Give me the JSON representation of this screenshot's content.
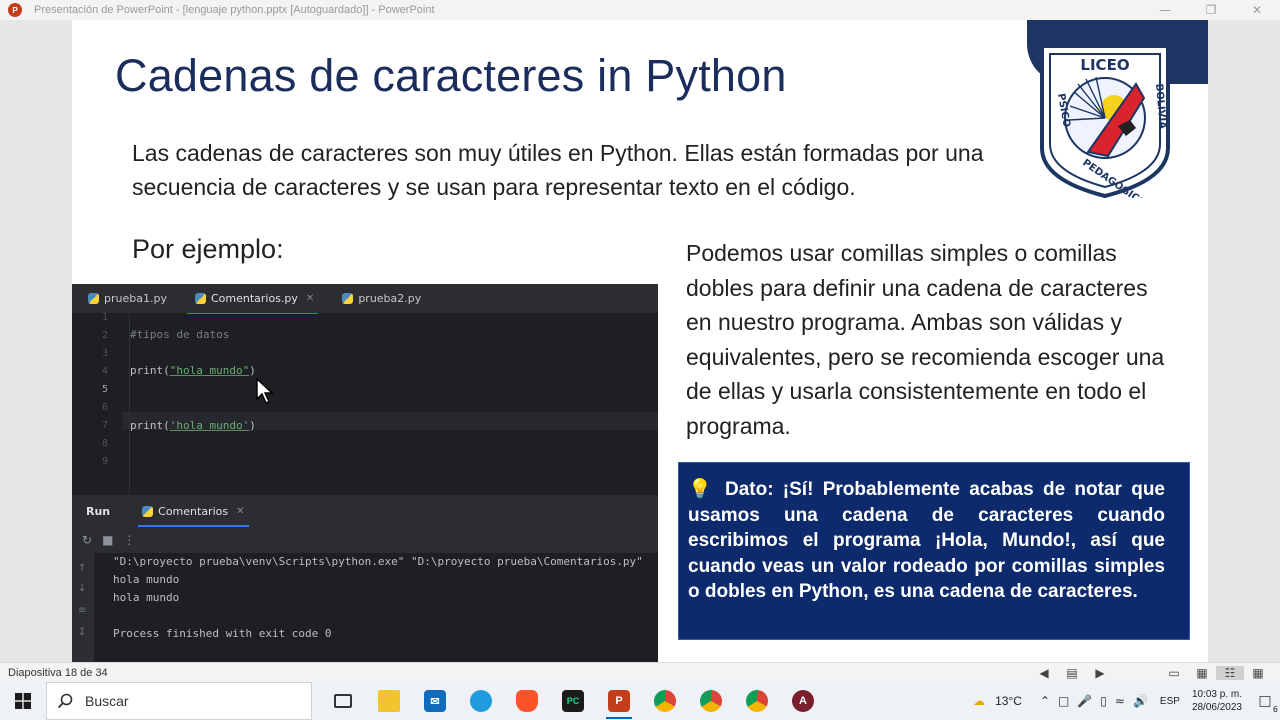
{
  "window": {
    "title": "Presentación de PowerPoint - [lenguaje python.pptx [Autoguardado]] - PowerPoint",
    "app_icon_letter": "P"
  },
  "slide": {
    "title": "Cadenas de caracteres in Python",
    "intro": "Las cadenas de caracteres son muy útiles en Python. Ellas están formadas por una secuencia de caracteres y se usan para representar texto en el código.",
    "por_ejemplo": "Por ejemplo:",
    "right_text": "Podemos usar comillas simples o comillas dobles para definir una cadena de caracteres en nuestro programa. Ambas son válidas y equivalentes, pero se recomienda escoger una de ellas y usarla consistentemente en todo el programa.",
    "dato_icon": "lightbulb-icon",
    "dato_text": "Dato: ¡Sí! Probablemente acabas de notar que usamos una cadena de caracteres cuando escribimos el programa ¡Hola, Mundo!, así que cuando veas un valor rodeado por comillas simples o dobles en Python, es una cadena de caracteres.",
    "logo": {
      "top_text": "LICEO",
      "left_text": "PSICOPEDAGOGICO",
      "right_text": "BOLIVIA"
    }
  },
  "ide": {
    "tabs": [
      {
        "label": "prueba1.py",
        "active": false,
        "closable": false
      },
      {
        "label": "Comentarios.py",
        "active": true,
        "closable": true
      },
      {
        "label": "prueba2.py",
        "active": false,
        "closable": false
      }
    ],
    "line_numbers": [
      "1",
      "2",
      "3",
      "4",
      "5",
      "6",
      "7",
      "8",
      "9"
    ],
    "current_line": "5",
    "code": {
      "line2": "#tipos de datos",
      "line4_fn": "print(",
      "line4_str": "\"hola mundo\"",
      "line4_end": ")",
      "line7_fn": "print(",
      "line7_str": "'hola mundo'",
      "line7_end": ")"
    },
    "run_panel": {
      "label": "Run",
      "tab": "Comentarios",
      "output": [
        "\"D:\\proyecto prueba\\venv\\Scripts\\python.exe\" \"D:\\proyecto prueba\\Comentarios.py\"",
        "hola mundo",
        "hola mundo",
        "",
        "Process finished with exit code 0"
      ]
    }
  },
  "statusbar": {
    "slide_indicator": "Diapositiva 18 de 34"
  },
  "taskbar": {
    "search_label": "Buscar",
    "apps": [
      {
        "name": "task-view-icon",
        "label": ""
      },
      {
        "name": "file-explorer-icon",
        "label": ""
      },
      {
        "name": "mail-icon",
        "label": ""
      },
      {
        "name": "edge-icon",
        "label": ""
      },
      {
        "name": "brave-icon",
        "label": ""
      },
      {
        "name": "pycharm-icon",
        "label": "PC"
      },
      {
        "name": "powerpoint-icon",
        "label": "P"
      },
      {
        "name": "chrome-icon-1",
        "label": ""
      },
      {
        "name": "chrome-icon-2",
        "label": ""
      },
      {
        "name": "chrome-icon-3",
        "label": ""
      },
      {
        "name": "app-a-icon",
        "label": "A"
      }
    ],
    "temperature": "13°C",
    "language": "ESP",
    "time": "10:03 p. m.",
    "date": "28/06/2023",
    "notification_count": "6"
  },
  "colors": {
    "title": "#1b2d5c",
    "dato_bg": "#0d2a6c",
    "ide_bg": "#1e1f22",
    "string": "#6aab73",
    "accent": "#3574f0"
  }
}
